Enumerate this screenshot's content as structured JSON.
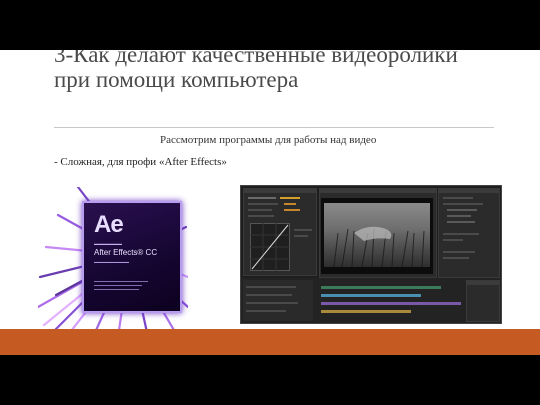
{
  "slide": {
    "title": "3-Как делают качественные видеоролики при помощи компьютера",
    "subtitle": "Рассмотрим программы для работы над видео",
    "item": "- Сложная, для профи «After Effects»"
  },
  "logo": {
    "letters": "Ae",
    "product_name": "After Effects® CC"
  },
  "colors": {
    "accent_bar": "#c55a22",
    "title_text": "#4a4a4a",
    "ae_purple": "#2a1050"
  }
}
